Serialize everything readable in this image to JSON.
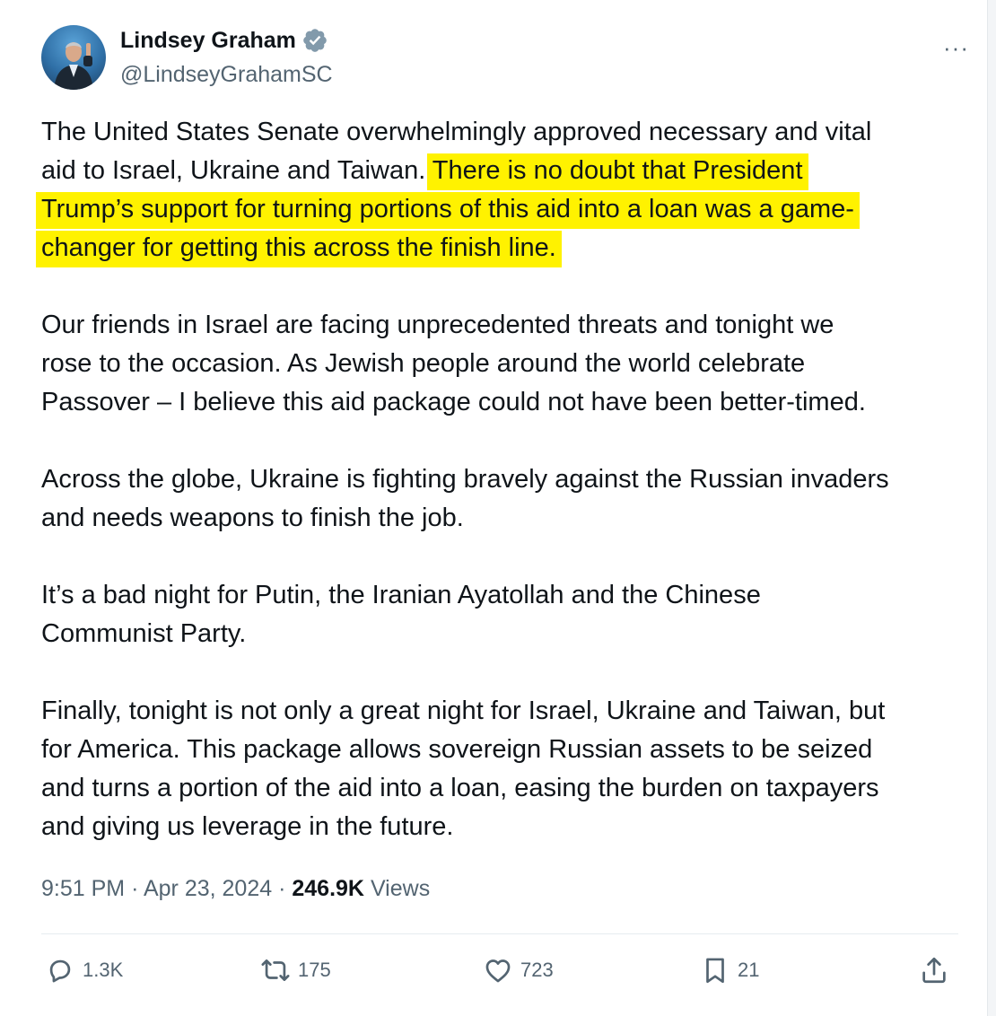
{
  "author": {
    "name": "Lindsey Graham",
    "handle": "@LindseyGrahamSC",
    "verified": true,
    "verified_color": "#829aab"
  },
  "menu": {
    "more_label": "···"
  },
  "tweet": {
    "paragraphs": [
      {
        "lines": [
          {
            "parts": [
              {
                "text": "The United States Senate overwhelmingly approved necessary and vital",
                "highlight": false
              }
            ]
          },
          {
            "parts": [
              {
                "text": "aid to Israel, Ukraine and Taiwan. ",
                "highlight": false
              },
              {
                "text": "There is no doubt that President",
                "highlight": true
              }
            ]
          },
          {
            "parts": [
              {
                "text": "Trump’s support for turning portions of this aid into a loan was a game-",
                "highlight": true
              }
            ]
          },
          {
            "parts": [
              {
                "text": "changer for getting this across the finish line.",
                "highlight": true
              }
            ]
          }
        ]
      },
      {
        "lines": [
          {
            "parts": [
              {
                "text": "Our friends in Israel are facing unprecedented threats and tonight we",
                "highlight": false
              }
            ]
          },
          {
            "parts": [
              {
                "text": "rose to the occasion. As Jewish people around the world celebrate",
                "highlight": false
              }
            ]
          },
          {
            "parts": [
              {
                "text": "Passover – I believe this aid package could not have been better-timed.",
                "highlight": false
              }
            ]
          }
        ]
      },
      {
        "lines": [
          {
            "parts": [
              {
                "text": "Across the globe, Ukraine is fighting bravely against the Russian invaders",
                "highlight": false
              }
            ]
          },
          {
            "parts": [
              {
                "text": "and needs weapons to finish the job.",
                "highlight": false
              }
            ]
          }
        ]
      },
      {
        "lines": [
          {
            "parts": [
              {
                "text": "It’s a bad night for Putin, the Iranian Ayatollah and the Chinese",
                "highlight": false
              }
            ]
          },
          {
            "parts": [
              {
                "text": "Communist Party.",
                "highlight": false
              }
            ]
          }
        ]
      },
      {
        "lines": [
          {
            "parts": [
              {
                "text": "Finally, tonight is not only a great night for Israel, Ukraine and Taiwan, but",
                "highlight": false
              }
            ]
          },
          {
            "parts": [
              {
                "text": "for America. This package allows sovereign Russian assets to be seized",
                "highlight": false
              }
            ]
          },
          {
            "parts": [
              {
                "text": "and turns a portion of the aid into a loan, easing the burden on taxpayers",
                "highlight": false
              }
            ]
          },
          {
            "parts": [
              {
                "text": "and giving us leverage in the future.",
                "highlight": false
              }
            ]
          }
        ]
      }
    ],
    "highlight_color": "#fff200"
  },
  "meta": {
    "time": "9:51 PM",
    "separator": "·",
    "date": "Apr 23, 2024",
    "views_count": "246.9K",
    "views_label": "Views"
  },
  "actions": {
    "replies": "1.3K",
    "reposts": "175",
    "likes": "723",
    "bookmarks": "21"
  },
  "icons": [
    "verified-badge-icon",
    "more-options-icon",
    "reply-icon",
    "repost-icon",
    "like-icon",
    "bookmark-icon",
    "share-icon"
  ]
}
